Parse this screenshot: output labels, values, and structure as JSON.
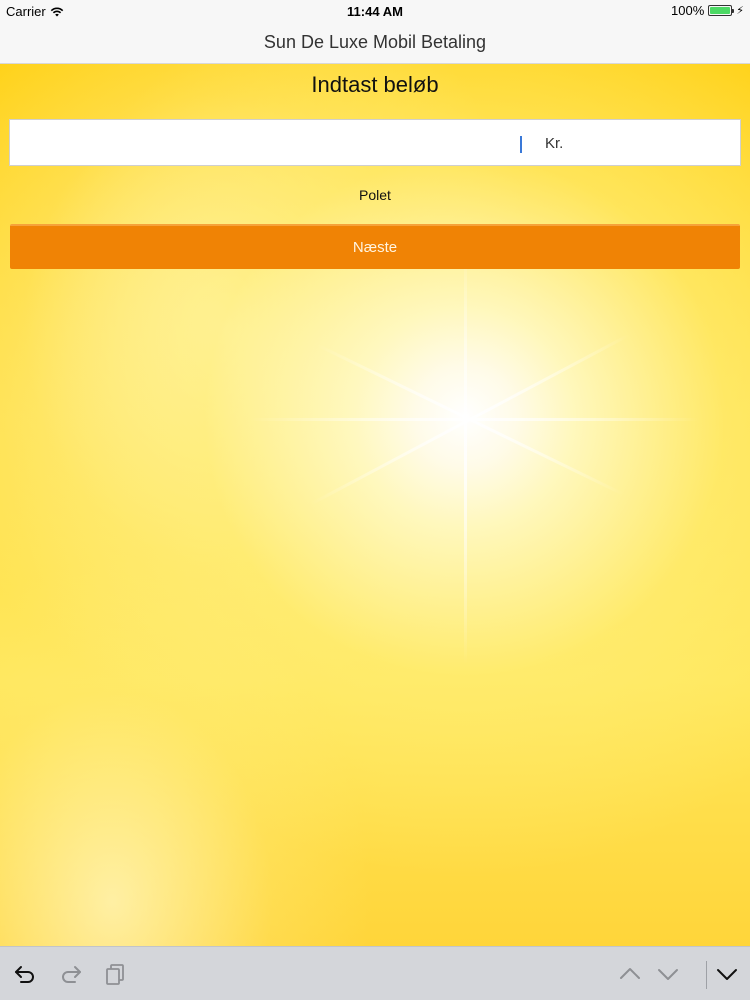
{
  "status_bar": {
    "carrier": "Carrier",
    "time": "11:44 AM",
    "battery": "100%",
    "battery_color": "#4cd964",
    "icons": [
      "wifi-icon",
      "battery-icon",
      "charging-bolt-icon"
    ]
  },
  "nav": {
    "title": "Sun De Luxe Mobil Betaling"
  },
  "form": {
    "heading": "Indtast beløb",
    "amount_value": "",
    "currency_suffix": "Kr.",
    "polet_label": "Polet",
    "next_button_label": "Næste"
  },
  "colors": {
    "accent_button": "#f08305",
    "background_sun": "#ffd21a"
  },
  "keyboard_toolbar": {
    "icons": [
      "undo-icon",
      "redo-icon",
      "paste-icon",
      "chevron-up-icon",
      "chevron-down-icon",
      "keyboard-dismiss-icon"
    ]
  }
}
